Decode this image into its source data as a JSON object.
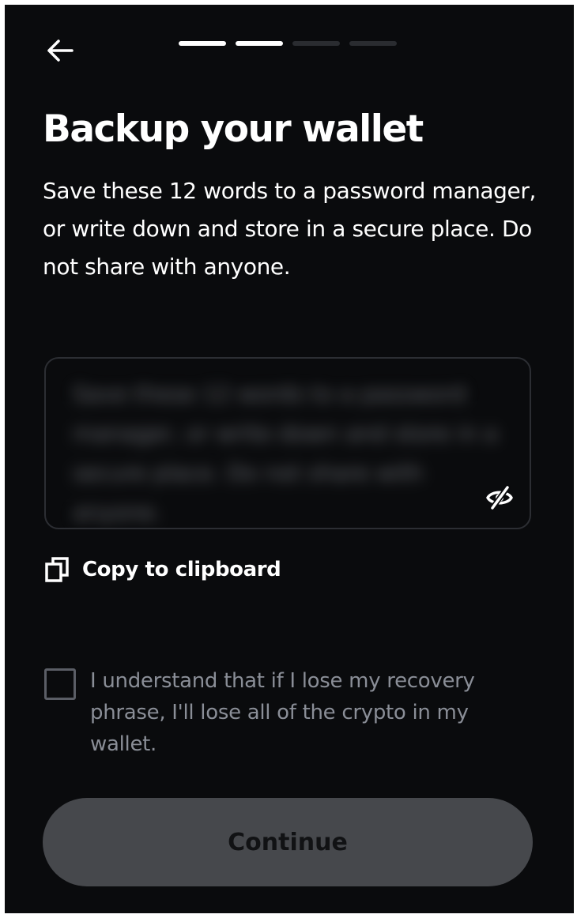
{
  "header": {
    "back_icon": "arrow-left-icon",
    "progress": {
      "total_steps": 4,
      "completed_steps": 2
    }
  },
  "title": "Backup your wallet",
  "subtitle": "Save these 12 words to a password manager, or write down and store in a secure place. Do not share with anyone.",
  "recovery_phrase": {
    "state": "hidden",
    "toggle_icon": "eye-off-icon"
  },
  "copy": {
    "icon": "copy-icon",
    "label": "Copy to clipboard"
  },
  "acknowledgement": {
    "checked": false,
    "label": "I understand that if I lose my recovery phrase, I'll lose all of the crypto in my wallet."
  },
  "continue_button": {
    "label": "Continue",
    "enabled": false
  },
  "colors": {
    "background": "#0a0b0d",
    "text_primary": "#ffffff",
    "text_muted": "#8a8e97",
    "progress_active": "#ffffff",
    "progress_inactive": "#2a2c30",
    "button_disabled_bg": "#46484c"
  }
}
